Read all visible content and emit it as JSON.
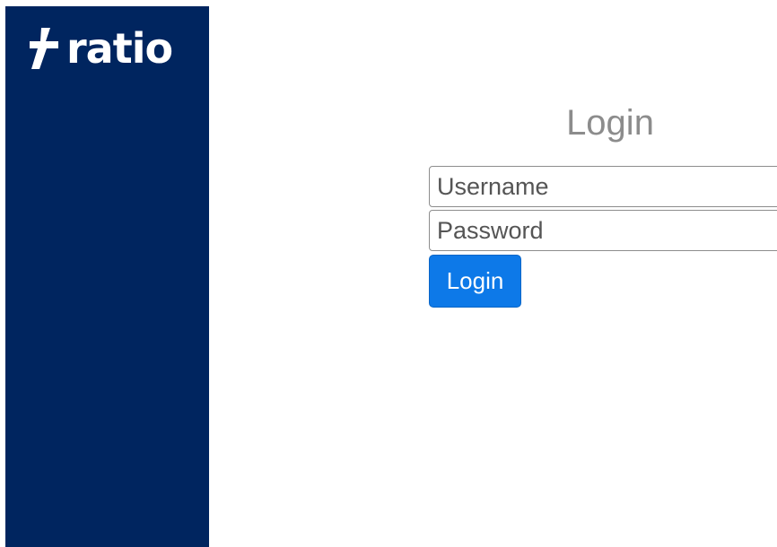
{
  "sidebar": {
    "brand": {
      "name": "ratio",
      "icon": "lightning-bolt-icon"
    }
  },
  "login_form": {
    "title": "Login",
    "username": {
      "placeholder": "Username",
      "value": ""
    },
    "password": {
      "placeholder": "Password",
      "value": ""
    },
    "submit_label": "Login"
  },
  "colors": {
    "sidebar_background": "#00255f",
    "button_background": "#0d79e8",
    "title_text": "#8c8c8c"
  }
}
